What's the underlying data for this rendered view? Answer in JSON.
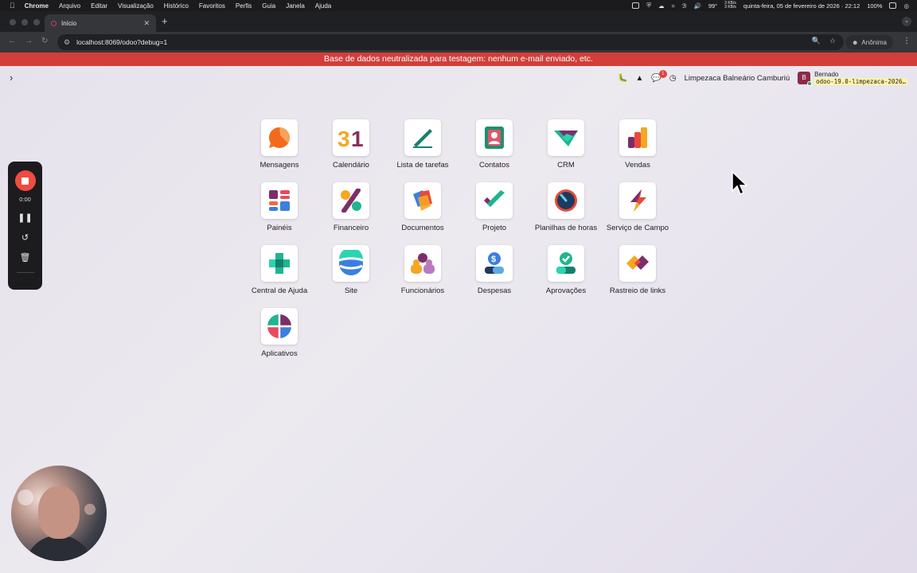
{
  "mac_menu": {
    "app": "Chrome",
    "items": [
      "Arquivo",
      "Editar",
      "Visualização",
      "Histórico",
      "Favoritos",
      "Perfis",
      "Guia",
      "Janela",
      "Ajuda"
    ],
    "temperature": "99°",
    "net_up": "3 KB/s",
    "net_down": "3 KB/s",
    "datetime": "quinta-feira, 05 de fevereiro de 2026 · 22:12",
    "battery": "100%"
  },
  "browser": {
    "tab_title": "Início",
    "url": "localhost:8069/odoo?debug=1",
    "profile": "Anônima"
  },
  "banner": "Base de dados neutralizada para testagem: nenhum e-mail enviado, etc.",
  "header": {
    "chat_badge": "1",
    "company": "Limpezaca Balneário Camburiú",
    "avatar_letter": "B",
    "user_name": "Bernado",
    "db_name": "odoo-19.0-limpezaca-2026…"
  },
  "apps": [
    {
      "label": "Mensagens",
      "icon": "discuss-icon"
    },
    {
      "label": "Calendário",
      "icon": "calendar-icon"
    },
    {
      "label": "Lista de tarefas",
      "icon": "todo-icon"
    },
    {
      "label": "Contatos",
      "icon": "contacts-icon"
    },
    {
      "label": "CRM",
      "icon": "crm-icon"
    },
    {
      "label": "Vendas",
      "icon": "sales-icon"
    },
    {
      "label": "Painéis",
      "icon": "dashboards-icon"
    },
    {
      "label": "Financeiro",
      "icon": "accounting-icon"
    },
    {
      "label": "Documentos",
      "icon": "documents-icon"
    },
    {
      "label": "Projeto",
      "icon": "project-icon"
    },
    {
      "label": "Planilhas de horas",
      "icon": "timesheets-icon"
    },
    {
      "label": "Serviço de Campo",
      "icon": "field-service-icon"
    },
    {
      "label": "Central de Ajuda",
      "icon": "helpdesk-icon"
    },
    {
      "label": "Site",
      "icon": "website-icon"
    },
    {
      "label": "Funcionários",
      "icon": "employees-icon"
    },
    {
      "label": "Despesas",
      "icon": "expenses-icon"
    },
    {
      "label": "Aprovações",
      "icon": "approvals-icon"
    },
    {
      "label": "Rastreio de links",
      "icon": "link-tracker-icon"
    },
    {
      "label": "Aplicativos",
      "icon": "apps-icon"
    }
  ],
  "recorder": {
    "time": "0:00"
  }
}
